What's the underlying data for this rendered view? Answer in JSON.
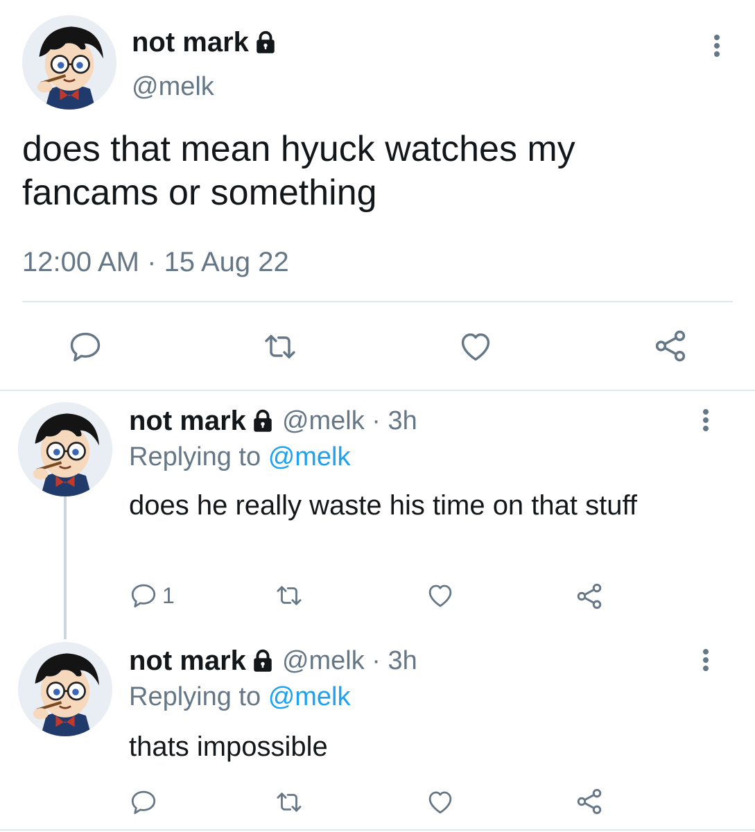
{
  "main_tweet": {
    "display_name": "not mark",
    "handle": "@melk",
    "text": "does that mean hyuck watches my fancams or something",
    "timestamp": "12:00 AM · 15 Aug 22",
    "locked_icon": "lock-icon",
    "actions": [
      "reply-icon",
      "retweet-icon",
      "like-icon",
      "share-icon"
    ]
  },
  "replies": [
    {
      "display_name": "not mark",
      "handle_time": "@melk · 3h",
      "replying_prefix": "Replying to",
      "replying_to": "@melk",
      "text": "does he really waste his time on that stuff",
      "reply_count": "1"
    },
    {
      "display_name": "not mark",
      "handle_time": "@melk · 3h",
      "replying_prefix": "Replying to",
      "replying_to": "@melk",
      "text": "thats impossible",
      "reply_count": ""
    }
  ],
  "colors": {
    "text": "#14171a",
    "secondary": "#657786",
    "link": "#1da1f2",
    "divider": "#e1e8ed"
  }
}
